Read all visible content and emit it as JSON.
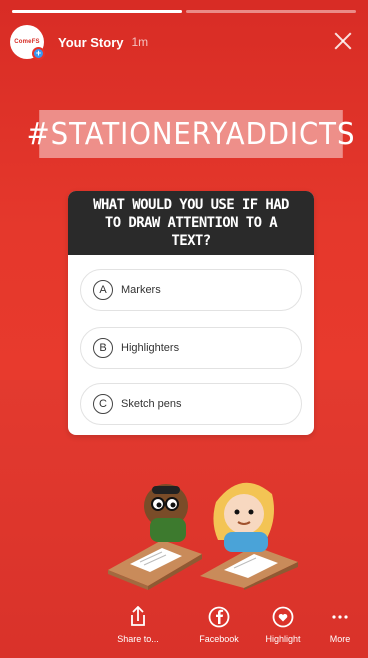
{
  "story": {
    "title": "Your Story",
    "time": "1m",
    "avatar_text": "ComeFS",
    "progress": [
      1.0,
      0.0
    ]
  },
  "hashtag": "#STATIONERYADDICTS",
  "poll": {
    "question": "WHAT WOULD YOU USE IF HAD TO DRAW ATTENTION TO A TEXT?",
    "options": [
      {
        "letter": "A",
        "label": "Markers"
      },
      {
        "letter": "B",
        "label": "Highlighters"
      },
      {
        "letter": "C",
        "label": "Sketch pens"
      }
    ]
  },
  "actions": [
    {
      "label": "Share to...",
      "icon": "share-icon"
    },
    {
      "label": "Facebook",
      "icon": "facebook-icon"
    },
    {
      "label": "Highlight",
      "icon": "highlight-icon"
    },
    {
      "label": "More",
      "icon": "more-icon"
    }
  ],
  "colors": {
    "background": "#e8322a",
    "poll_header": "#2a2a2a"
  }
}
